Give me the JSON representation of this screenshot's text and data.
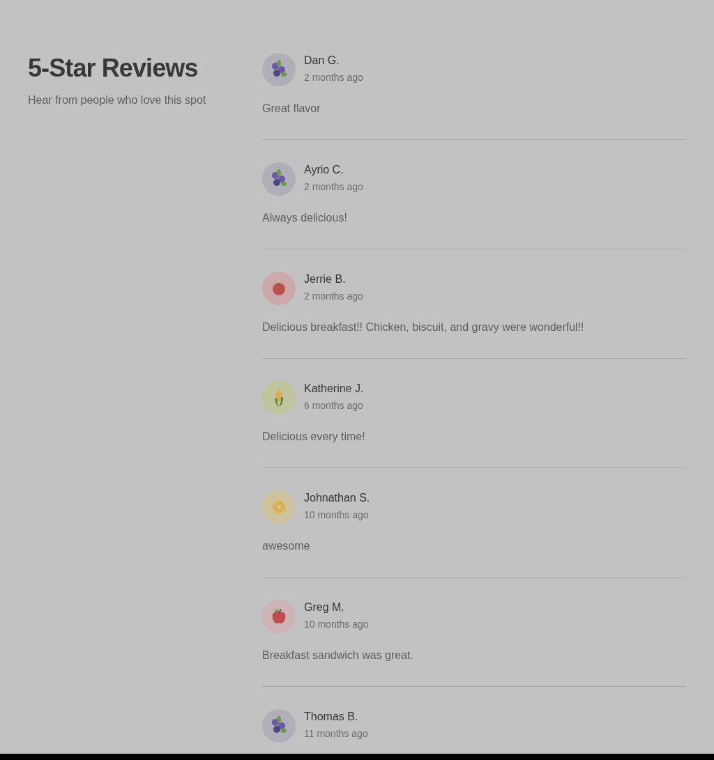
{
  "header": {
    "title": "5-Star Reviews",
    "subtitle": "Hear from people who love this spot"
  },
  "reviews": [
    {
      "kind": "blueberry",
      "name": "Dan G.",
      "time": "2 months ago",
      "text": "Great flavor"
    },
    {
      "kind": "blueberry",
      "name": "Ayrio C.",
      "time": "2 months ago",
      "text": "Always delicious!"
    },
    {
      "kind": "tomato",
      "name": "Jerrie B.",
      "time": "2 months ago",
      "text": "Delicious breakfast!! Chicken, biscuit, and gravy were wonderful!!"
    },
    {
      "kind": "corn",
      "name": "Katherine J.",
      "time": "6 months ago",
      "text": "Delicious every time!"
    },
    {
      "kind": "lemon",
      "name": "Johnathan S.",
      "time": "10 months ago",
      "text": "awesome"
    },
    {
      "kind": "apple",
      "name": "Greg M.",
      "time": "10 months ago",
      "text": "Breakfast sandwich was great."
    },
    {
      "kind": "blueberry",
      "name": "Thomas B.",
      "time": "11 months ago"
    }
  ]
}
